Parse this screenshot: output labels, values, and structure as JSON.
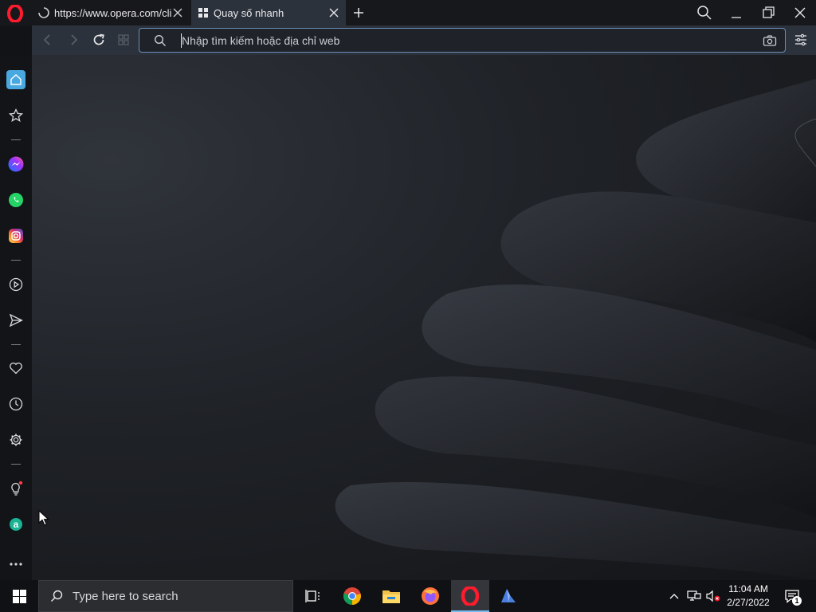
{
  "tabs": [
    {
      "title": "https://www.opera.com/client/upgraded?utm_source=NTP",
      "loading": true
    },
    {
      "title": "Quay số nhanh",
      "active": true
    }
  ],
  "address_bar": {
    "placeholder": "Nhập tìm kiếm hoặc địa chỉ web"
  },
  "sidebar": {
    "items": [
      "home-icon",
      "bookmarks-icon",
      "messenger-icon",
      "whatsapp-icon",
      "instagram-icon",
      "player-icon",
      "send-icon",
      "heart-icon",
      "history-icon",
      "settings-icon",
      "tips-icon",
      "aria-icon",
      "more-icon"
    ]
  },
  "taskbar": {
    "search_placeholder": "Type here to search",
    "time": "11:04 AM",
    "date": "2/27/2022",
    "notification_count": "1"
  },
  "colors": {
    "opera_red": "#ff1b2d",
    "accent_blue": "#4aa8e0",
    "tab_active": "#2c323c"
  }
}
